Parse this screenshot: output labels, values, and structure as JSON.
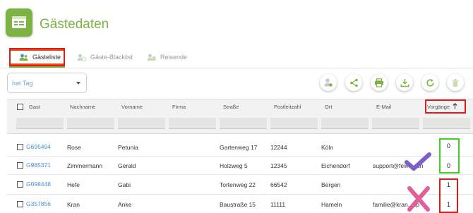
{
  "header": {
    "title": "Gästedaten",
    "icon": "guest-card-icon"
  },
  "tabs": [
    {
      "label": "Gästeliste",
      "icon": "guests-icon",
      "active": true
    },
    {
      "label": "Gäste-Blacklist",
      "icon": "guests-blocked-icon",
      "active": false
    },
    {
      "label": "Reisende",
      "icon": "travelers-icon",
      "active": false
    }
  ],
  "filter_select": {
    "value": "hat Tag"
  },
  "toolbar": [
    "assign-guest-icon",
    "share-icon",
    "print-icon",
    "download-icon",
    "refresh-icon",
    "trash-icon"
  ],
  "table": {
    "columns": [
      "Gast",
      "Nachname",
      "Vorname",
      "Firma",
      "Straße",
      "Postleitzahl",
      "Ort",
      "E-Mail",
      "Vorgänge"
    ],
    "sort_column": "Vorgänge",
    "sort_direction": "asc",
    "rows": [
      {
        "gast": "G695494",
        "nachname": "Rose",
        "vorname": "Petunia",
        "firma": "",
        "strasse": "Gartenweg 17",
        "plz": "12244",
        "ort": "Köln",
        "email": "",
        "vorgaenge": "0"
      },
      {
        "gast": "G985371",
        "nachname": "Zimmermann",
        "vorname": "Gerald",
        "firma": "",
        "strasse": "Holzweg 5",
        "plz": "12345",
        "ort": "Eichendorf",
        "email": "support@fewo...an",
        "vorgaenge": "0"
      },
      {
        "gast": "G098448",
        "nachname": "Hefe",
        "vorname": "Gabi",
        "firma": "",
        "strasse": "Tortenweg 22",
        "plz": "66542",
        "ort": "Bergen",
        "email": "",
        "vorgaenge": "1"
      },
      {
        "gast": "G357856",
        "nachname": "Kran",
        "anke": "",
        "vorname": "Anke",
        "firma": "",
        "strasse": "Baustraße 15",
        "plz": "11111",
        "ort": "Hameln",
        "email": "familie@kran...pp",
        "vorgaenge": "1"
      }
    ]
  },
  "annotations": {
    "checkmark_color": "#7b5ec9",
    "cross_color": "#e0609a",
    "red_box_color": "#e01b1b",
    "green_box_color": "#3fcf1f"
  }
}
